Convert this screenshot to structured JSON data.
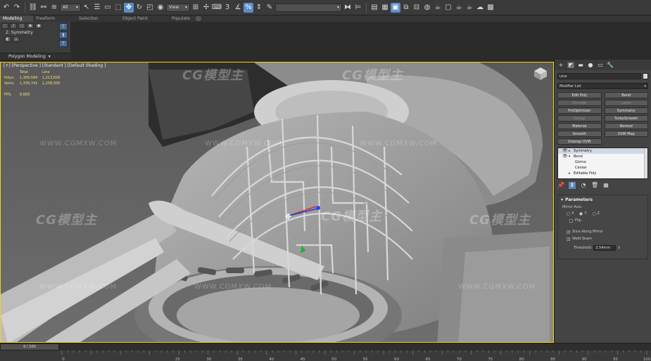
{
  "toolbar": {
    "selection_filter": "All",
    "ref_coord": "View",
    "snap_label": "3",
    "named_sel": ""
  },
  "ribbon": {
    "tabs": [
      "Modeling",
      "Freeform",
      "Selection",
      "Object Paint",
      "Populate"
    ],
    "active_tab": "Modeling",
    "current_modifier": "2: Symmetry",
    "panel_label": "Polygon Modeling"
  },
  "viewport": {
    "label": "[+] [Perspective ] [Standard ] [Default Shading ]",
    "stats_header": [
      "Total",
      "Line"
    ],
    "stats": [
      {
        "name": "Polys:",
        "total": "1,309,584",
        "line": "1,213,656"
      },
      {
        "name": "Verts:",
        "total": "1,339,741",
        "line": "1,258,500"
      }
    ],
    "fps_label": "FPS:",
    "fps_value": "8.683",
    "watermark_logo": "CG模型主",
    "watermark_url": "WWW.CGMXW.COM"
  },
  "command_panel": {
    "object_name": "Line",
    "modifier_list": "Modifier List",
    "modifier_buttons": [
      {
        "label": "Edit Poly",
        "dim": false
      },
      {
        "label": "Bend",
        "dim": false
      },
      {
        "label": "Extrude",
        "dim": true
      },
      {
        "label": "Lathe",
        "dim": true
      },
      {
        "label": "ProOptimizer",
        "dim": false
      },
      {
        "label": "Symmetry",
        "dim": false
      },
      {
        "label": "Sweep",
        "dim": true
      },
      {
        "label": "TurboSmooth",
        "dim": false
      },
      {
        "label": "Material",
        "dim": false
      },
      {
        "label": "Normal",
        "dim": false
      },
      {
        "label": "Smooth",
        "dim": false
      },
      {
        "label": "UVW Map",
        "dim": false
      },
      {
        "label": "Unwrap UVW",
        "dim": false
      }
    ],
    "stack": [
      {
        "label": "Symmetry",
        "eye": true,
        "expand": true,
        "sub": false,
        "selected": true
      },
      {
        "label": "Bend",
        "eye": true,
        "expand": true,
        "sub": false,
        "selected": false
      },
      {
        "label": "Gizmo",
        "eye": false,
        "expand": false,
        "sub": true,
        "selected": false
      },
      {
        "label": "Center",
        "eye": false,
        "expand": false,
        "sub": true,
        "selected": false
      },
      {
        "label": "Editable Poly",
        "eye": false,
        "expand": true,
        "sub": false,
        "selected": false
      }
    ],
    "params": {
      "title": "Parameters",
      "mirror_axis_label": "Mirror Axis:",
      "axes": [
        {
          "label": "X",
          "on": false
        },
        {
          "label": "Y",
          "on": true
        },
        {
          "label": "Z",
          "on": false
        }
      ],
      "flip_label": "Flip",
      "slice_label": "Slice Along Mirror",
      "weld_label": "Weld Seam",
      "threshold_label": "Threshold:",
      "threshold_value": "2.54mm"
    }
  },
  "timeline": {
    "frame_display": "0 / 100",
    "ticks": [
      "0",
      "25",
      "30",
      "35",
      "40",
      "45",
      "50",
      "55",
      "60",
      "65",
      "70",
      "75",
      "80",
      "85",
      "90",
      "95",
      "100"
    ]
  }
}
